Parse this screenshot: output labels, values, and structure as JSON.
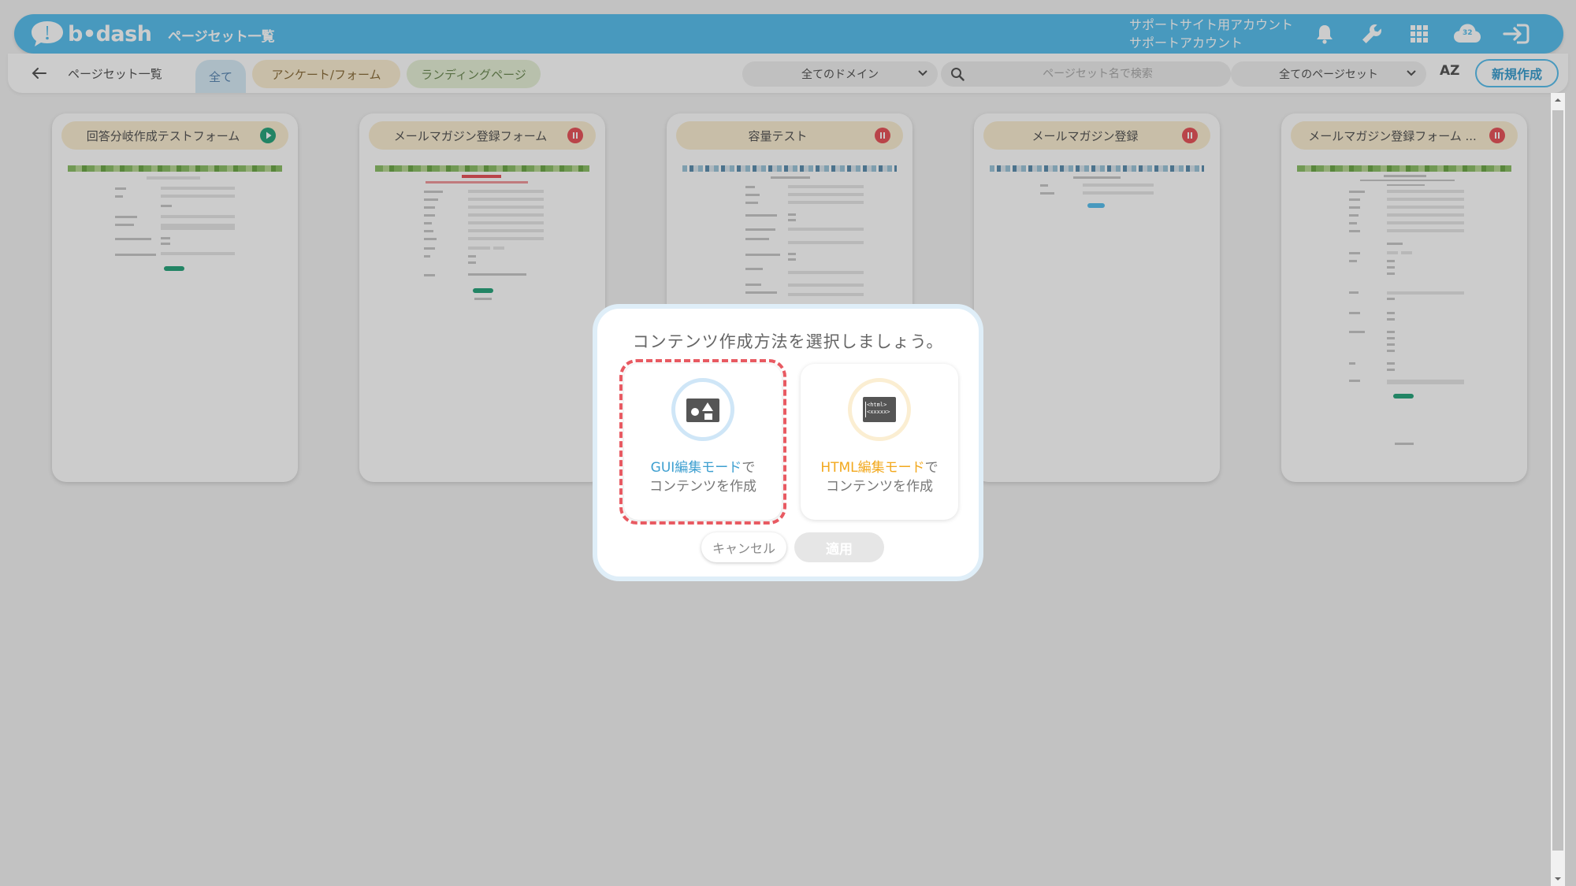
{
  "header": {
    "logo_text": "b•dash",
    "title": "ページセット一覧",
    "account_line1": "サポートサイト用アカウント",
    "account_line2": "サポートアカウント",
    "icons": [
      "bell-icon",
      "wrench-icon",
      "grid-icon",
      "cloud-sync-icon",
      "logout-icon"
    ],
    "badge": "32"
  },
  "toolbar": {
    "breadcrumb": "ページセット一覧",
    "tabs": [
      {
        "label": "全て",
        "active": true
      },
      {
        "label": "アンケート/フォーム"
      },
      {
        "label": "ランディングページ"
      }
    ],
    "domain_select": "全てのドメイン",
    "search_placeholder": "ページセット名で検索",
    "pageset_select": "全てのページセット",
    "sort_label": "AZ",
    "new_button": "新規作成"
  },
  "cards": [
    {
      "title": "回答分岐作成テストフォーム",
      "status": "play"
    },
    {
      "title": "メールマガジン登録フォーム",
      "status": "pause"
    },
    {
      "title": "容量テスト",
      "status": "pause"
    },
    {
      "title": "メールマガジン登録",
      "status": "pause"
    },
    {
      "title": "メールマガジン登録フォーム ...",
      "status": "pause"
    }
  ],
  "modal": {
    "title": "コンテンツ作成方法を選択しましょう。",
    "gui_option": {
      "highlight": "GUI編集モード",
      "suffix": "で",
      "line2": "コンテンツを作成"
    },
    "html_option": {
      "highlight": "HTML編集モード",
      "suffix": "で",
      "line2": "コンテンツを作成"
    },
    "cancel_button": "キャンセル",
    "apply_button": "適用"
  },
  "colors": {
    "brand": "#5bc0ee",
    "highlight_red": "#e85a62",
    "html_orange": "#f2a81d",
    "play_green": "#2ba57d"
  }
}
